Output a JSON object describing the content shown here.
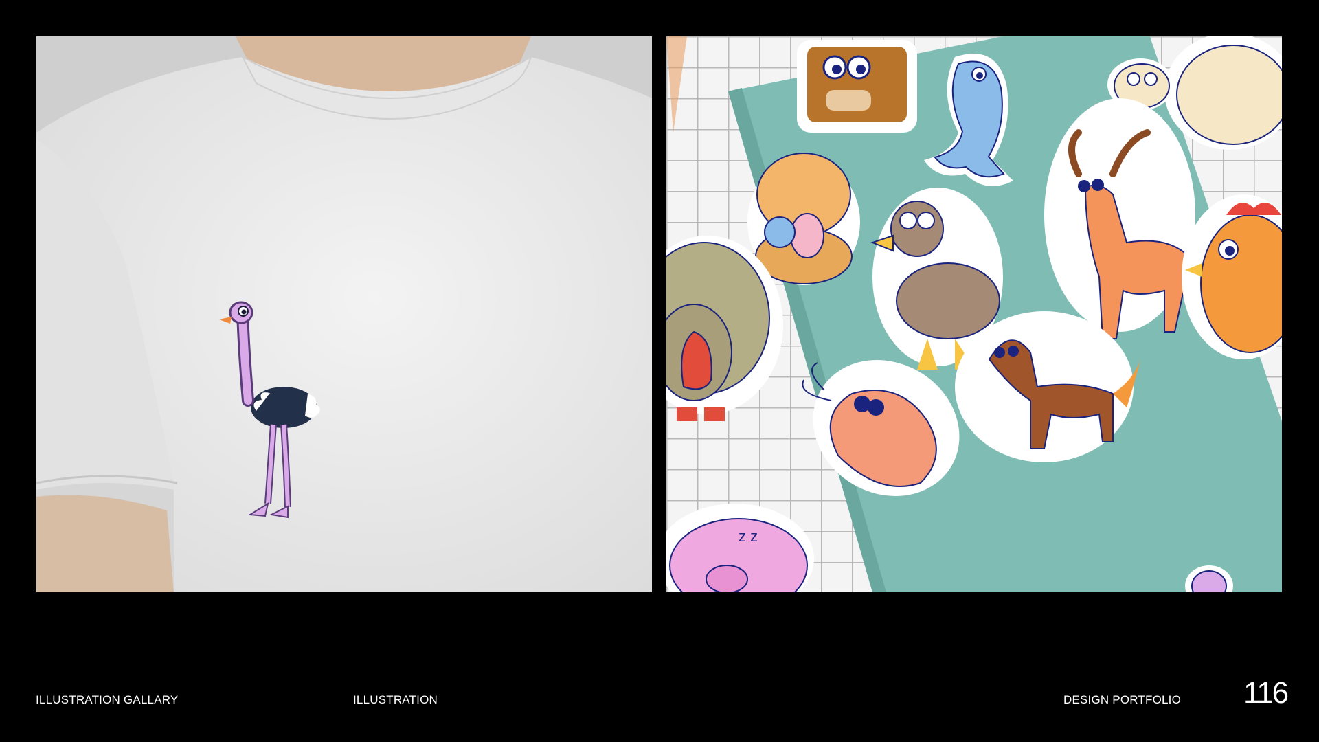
{
  "footer": {
    "left": "ILLUSTRATION GALLARY",
    "middle": "ILLUSTRATION",
    "right": "DESIGN PORTFOLIO",
    "page_number": "116"
  },
  "images": [
    {
      "subject": "white t-shirt mockup with ostrich illustration"
    },
    {
      "subject": "animal sticker set on teal notebook over white tiles"
    }
  ],
  "colors": {
    "background": "#000000",
    "text": "#ffffff",
    "shirt": "#ececec",
    "notebook": "#7fbdb4",
    "tile": "#f2f2f2"
  }
}
